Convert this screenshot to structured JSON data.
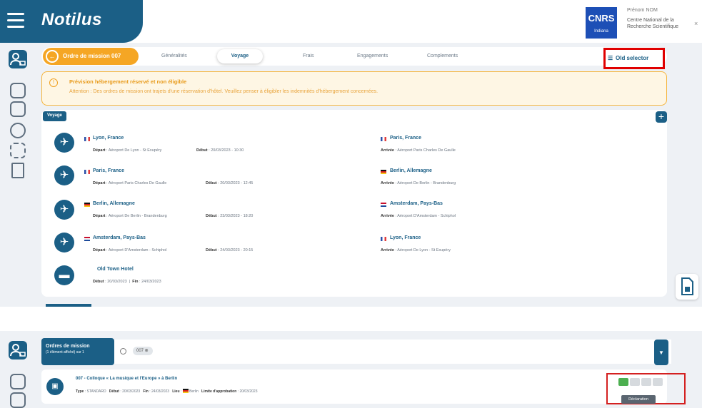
{
  "app": {
    "name": "Notilus"
  },
  "header": {
    "org_logo": "CNRS",
    "org_logo_sub": "Indiana",
    "user_label": "Prénom NOM",
    "org_name_line1": "Centre National de la",
    "org_name_line2": "Recherche Scientifique",
    "close": "×"
  },
  "tabs": {
    "order": "Ordre de mission 007",
    "order_icon": "←",
    "items": [
      "Généralités",
      "Voyage",
      "Frais",
      "Engagements",
      "Complements"
    ],
    "active_index": 1,
    "old_selector": "Old selector"
  },
  "warning": {
    "title": "Prévision hébergement réservé et non éligible",
    "text": "Attention : Des ordres de mission ont trajets d'une réservation d'hôtel. Veuillez penser à éligibler les indemnités d'hébergement concernées."
  },
  "voyage": {
    "label": "Voyage",
    "add": "+",
    "legs": [
      {
        "from_city": "Lyon, France",
        "from_flag": "fr",
        "from_detail_label": "Départ",
        "from_detail": "Aéroport De Lyon - St Exupéry",
        "date_label": "Début",
        "date": "20/03/2023 - 10:30",
        "to_city": "Paris, France",
        "to_flag": "fr",
        "to_detail_label": "Arrivée",
        "to_detail": "Aéroport Paris Charles De Gaulle"
      },
      {
        "from_city": "Paris, France",
        "from_flag": "fr",
        "from_detail_label": "Départ",
        "from_detail": "Aéroport Paris Charles De Gaulle",
        "date_label": "Début",
        "date": "20/03/2023 - 12:45",
        "to_city": "Berlin, Allemagne",
        "to_flag": "de",
        "to_detail_label": "Arrivée",
        "to_detail": "Aéroport De Berlin - Brandenburg"
      },
      {
        "from_city": "Berlin, Allemagne",
        "from_flag": "de",
        "from_detail_label": "Départ",
        "from_detail": "Aéroport De Berlin - Brandenburg",
        "date_label": "Début",
        "date": "23/03/2023 - 18:20",
        "to_city": "Amsterdam, Pays-Bas",
        "to_flag": "nl",
        "to_detail_label": "Arrivée",
        "to_detail": "Aéroport D'Amsterdam - Schiphol"
      },
      {
        "from_city": "Amsterdam, Pays-Bas",
        "from_flag": "nl",
        "from_detail_label": "Départ",
        "from_detail": "Aéroport D'Amsterdam - Schiphol",
        "date_label": "Début",
        "date": "24/03/2023 - 20:15",
        "to_city": "Lyon, France",
        "to_flag": "fr",
        "to_detail_label": "Arrivée",
        "to_detail": "Aéroport De Lyon - St Exupéry"
      }
    ],
    "hotel": {
      "name": "Old Town Hotel",
      "start_label": "Début",
      "start": "20/03/2023",
      "end_label": "Fin",
      "end": "24/03/2023"
    }
  },
  "list": {
    "header_title": "Ordres de mission",
    "header_sub": "(1 élément affiché) sur 1",
    "search_chip": "007 ⊗",
    "filter_icon": "▼",
    "row": {
      "title": "007 - Colloque « La musique et l'Europe » à Berlin",
      "type_label": "Type",
      "type": "STANDARD",
      "start_label": "Début",
      "start": "20/03/2023",
      "end_label": "Fin",
      "end": "24/03/2023",
      "place_label": "Lieu",
      "place": "Berlin",
      "approval_label": "Limite d'approbation",
      "approval": "20/03/2023"
    },
    "steps_done": 1,
    "steps_total": 4,
    "tooltip": "Déclaration"
  }
}
